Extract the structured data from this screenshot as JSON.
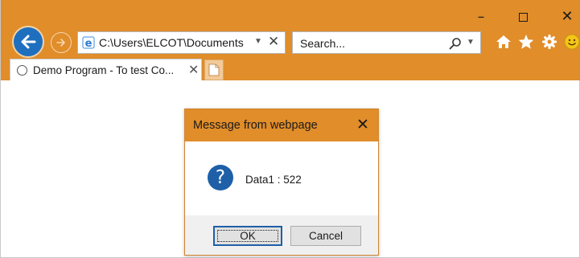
{
  "browser": {
    "window_controls": {
      "minimize": "–",
      "close": "✕"
    },
    "address": {
      "url": "C:\\Users\\ELCOT\\Documents",
      "dropdown": "▼",
      "clear": "✕"
    },
    "search": {
      "placeholder": "Search...",
      "dropdown": "▼"
    },
    "tab": {
      "label": "Demo Program - To test Co...",
      "close": "✕"
    },
    "toolbar_icons": [
      "home-icon",
      "favorites-star-icon",
      "settings-gear-icon",
      "feedback-smiley-icon"
    ],
    "colors": {
      "chrome": "#e08d2a",
      "back_button": "#1f6fbf"
    }
  },
  "dialog": {
    "title": "Message from webpage",
    "close": "✕",
    "icon": "?",
    "message": "Data1 : 522",
    "buttons": {
      "ok": "OK",
      "cancel": "Cancel"
    }
  }
}
